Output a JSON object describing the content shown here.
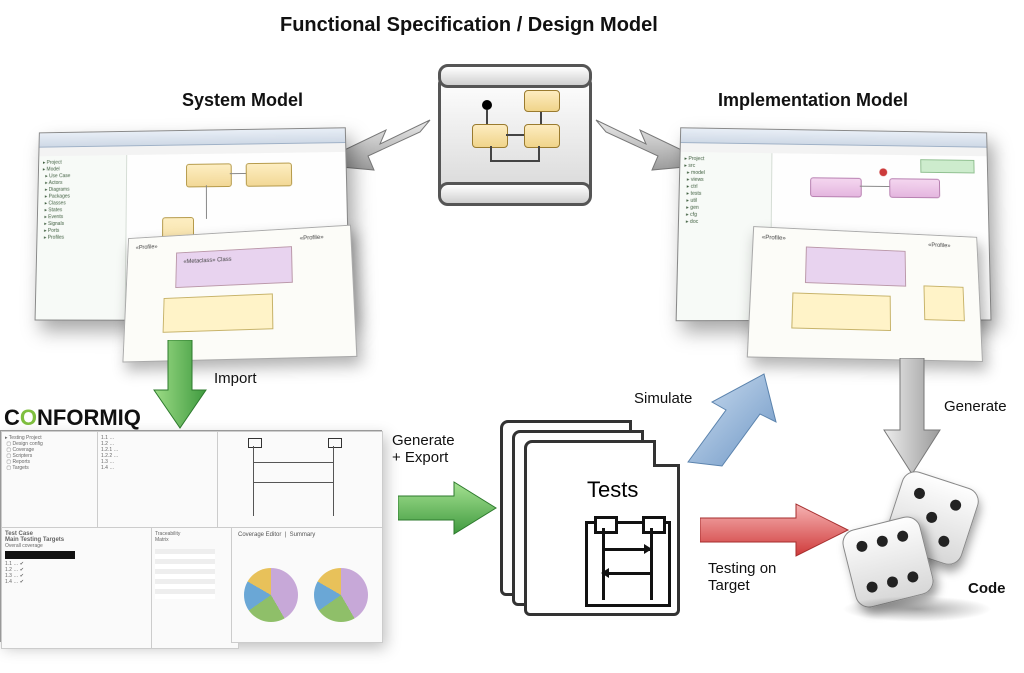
{
  "title": "Functional Specification / Design Model",
  "labels": {
    "system_model": "System Model",
    "implementation_model": "Implementation Model",
    "import": "Import",
    "generate_export": "Generate\n+ Export",
    "simulate": "Simulate",
    "generate": "Generate",
    "testing_on_target": "Testing on\nTarget",
    "tests": "Tests",
    "code": "Code",
    "conformiq": "CONFORMIQ"
  },
  "flow": {
    "nodes": [
      {
        "id": "spec",
        "name": "Functional Specification / Design Model"
      },
      {
        "id": "system",
        "name": "System Model"
      },
      {
        "id": "impl",
        "name": "Implementation Model"
      },
      {
        "id": "conformiq",
        "name": "Conformiq tool"
      },
      {
        "id": "tests",
        "name": "Tests"
      },
      {
        "id": "code",
        "name": "Code"
      }
    ],
    "edges": [
      {
        "from": "spec",
        "to": "system",
        "label": ""
      },
      {
        "from": "spec",
        "to": "impl",
        "label": ""
      },
      {
        "from": "system",
        "to": "conformiq",
        "label": "Import",
        "color": "green"
      },
      {
        "from": "conformiq",
        "to": "tests",
        "label": "Generate + Export",
        "color": "green"
      },
      {
        "from": "tests",
        "to": "impl",
        "label": "Simulate",
        "color": "blue"
      },
      {
        "from": "impl",
        "to": "code",
        "label": "Generate",
        "color": "gray"
      },
      {
        "from": "tests",
        "to": "code",
        "label": "Testing on Target",
        "color": "red"
      }
    ]
  },
  "colors": {
    "arrow_gray_light": "#e5e5e5",
    "arrow_gray_dark": "#9a9a9a",
    "arrow_green_light": "#8fd67a",
    "arrow_green_dark": "#3f9e3f",
    "arrow_blue_light": "#bcd3ec",
    "arrow_blue_dark": "#6f97c6",
    "arrow_red_light": "#f4a3a3",
    "arrow_red_dark": "#d24545"
  }
}
